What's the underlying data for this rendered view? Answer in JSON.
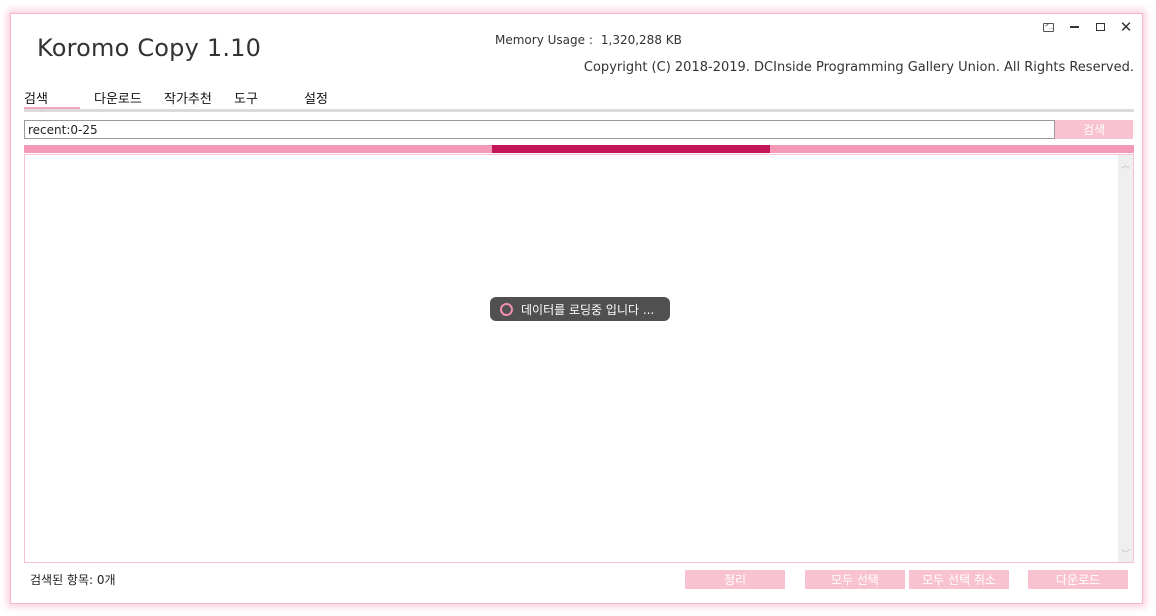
{
  "app": {
    "title": "Koromo Copy 1.10"
  },
  "header": {
    "memory_label": "Memory Usage :",
    "memory_value": "1,320,288 KB",
    "copyright": "Copyright (C) 2018-2019. DCInside Programming Gallery Union. All Rights Reserved."
  },
  "window_controls": [
    "console-icon",
    "minimize-icon",
    "maximize-icon",
    "close-icon"
  ],
  "tabs": [
    {
      "label": "검색",
      "active": true
    },
    {
      "label": "다운로드"
    },
    {
      "label": "작가추천"
    },
    {
      "label": "도구"
    },
    {
      "label": "설정"
    }
  ],
  "search": {
    "value": "recent:0-25",
    "button_label": "검색"
  },
  "progress": {
    "start_fraction": 0.422,
    "end_fraction": 0.672
  },
  "loading": {
    "text": "데이터를 로딩중 입니다 ..."
  },
  "footer": {
    "count_text": "검색된 항목: 0개",
    "buttons": {
      "arrange": "정리",
      "select_all": "모두 선택",
      "deselect_all": "모두 선택 취소",
      "download": "다운로드"
    }
  },
  "colors": {
    "accent": "#f59ab6",
    "accent_dark": "#c3165a",
    "button": "#f9c2d0"
  }
}
